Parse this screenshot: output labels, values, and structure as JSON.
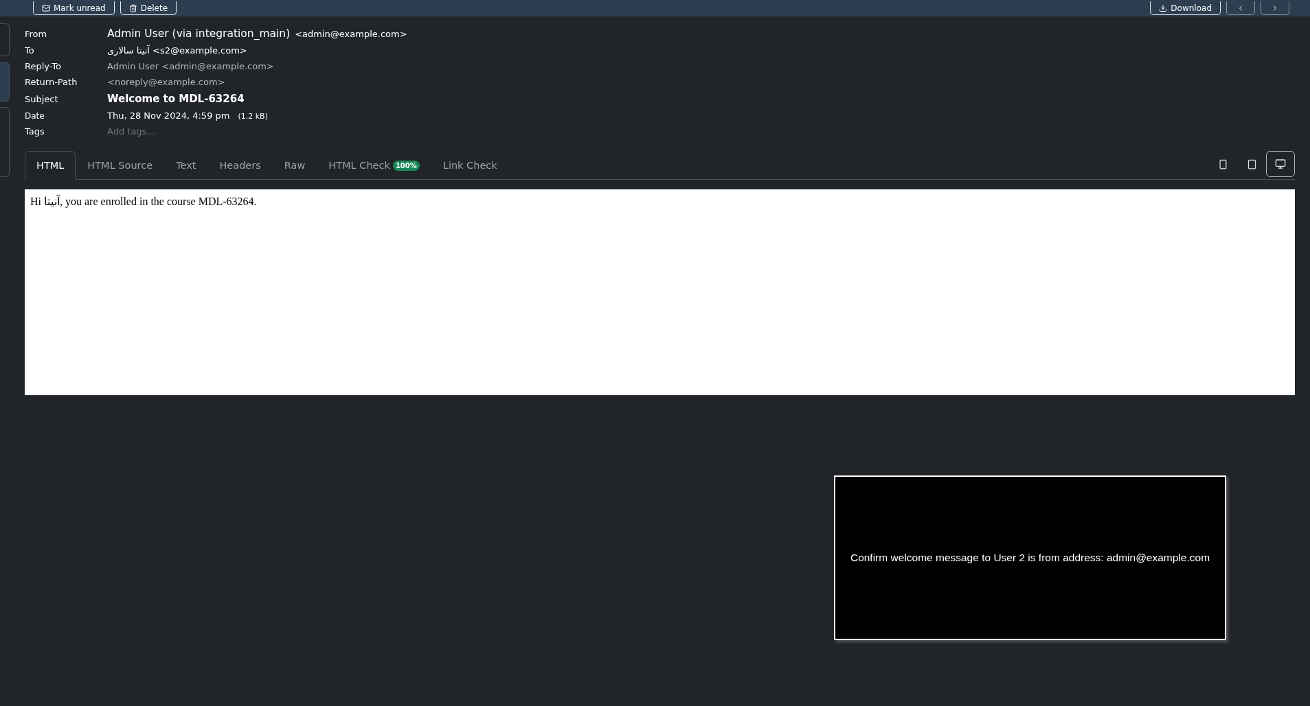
{
  "toolbar": {
    "left_buttons": [
      {
        "label": "Mark unread",
        "kind": "envelope"
      },
      {
        "label": "Delete",
        "kind": "trash"
      }
    ],
    "right_buttons": [
      {
        "label": "Download",
        "kind": "download"
      },
      {
        "kind": "prev"
      },
      {
        "kind": "next"
      }
    ]
  },
  "headers": [
    {
      "label": "From",
      "value": "Admin User (via integration_main)",
      "extra": "<admin@example.com>",
      "kind": "from"
    },
    {
      "label": "To",
      "value": "آنیتا سالاری <s2@example.com>",
      "kind": "normal"
    },
    {
      "label": "Reply-To",
      "value": "Admin User <admin@example.com>",
      "kind": "muted"
    },
    {
      "label": "Return-Path",
      "value": "<noreply@example.com>",
      "kind": "muted"
    },
    {
      "label": "Subject",
      "value": "Welcome to MDL-63264",
      "kind": "subject"
    },
    {
      "label": "Date",
      "value": "Thu, 28 Nov 2024, 4:59 pm",
      "extra": "(1.2 kB)",
      "kind": "date"
    },
    {
      "label": "Tags",
      "placeholder": "Add tags...",
      "kind": "placeholder"
    }
  ],
  "tabs": [
    {
      "label": "HTML",
      "selected": true
    },
    {
      "label": "HTML Source",
      "selected": false
    },
    {
      "label": "Text",
      "selected": false
    },
    {
      "label": "Headers",
      "selected": false
    },
    {
      "label": "Raw",
      "selected": false
    },
    {
      "label": "HTML Check",
      "badge": "100%",
      "selected": false
    },
    {
      "label": "Link Check",
      "selected": false
    }
  ],
  "view_modes": [
    {
      "kind": "phone",
      "selected": false
    },
    {
      "kind": "tablet",
      "selected": false
    },
    {
      "kind": "desktop",
      "selected": true
    }
  ],
  "message_body": "Hi آنیتا, you are enrolled in the course MDL-63264.",
  "overlay": {
    "text": "Confirm welcome message to User 2 is from address: admin@example.com"
  }
}
